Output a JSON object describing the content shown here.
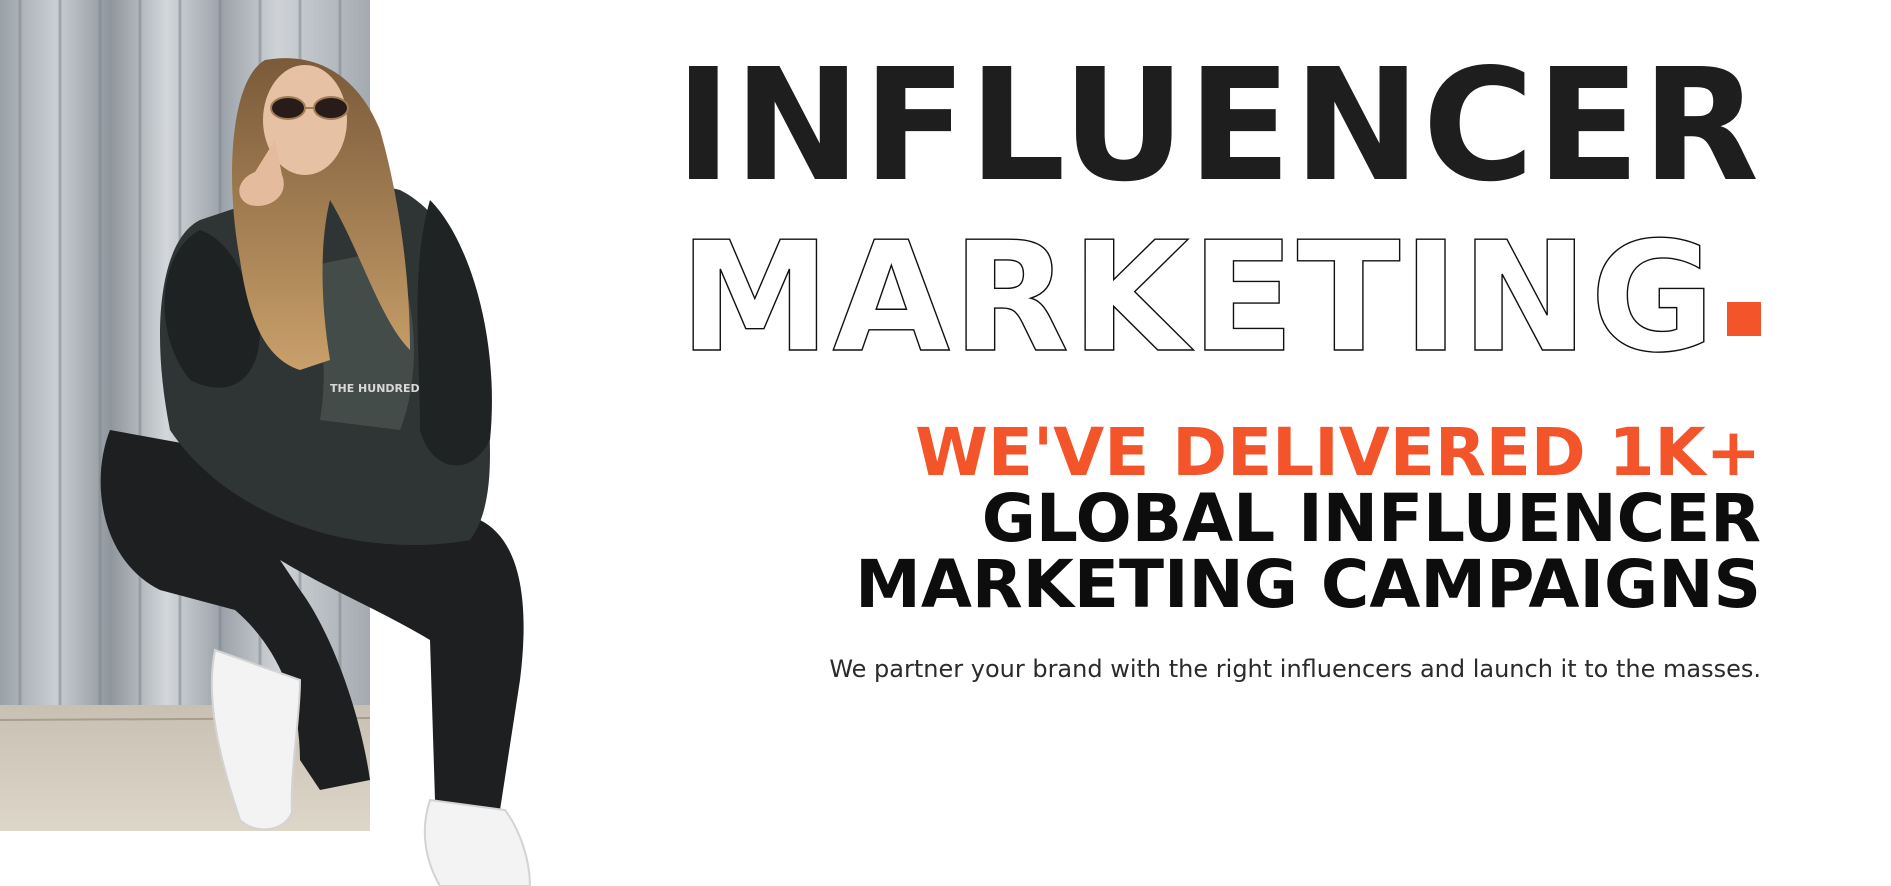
{
  "hero": {
    "image_icon": "person-photo-icon",
    "headline_line_1": "INFLUENCER",
    "headline_line_2": "MARKETING",
    "tagline_accent": "WE'VE DELIVERED 1K+",
    "tagline_line_2": "GLOBAL INFLUENCER",
    "tagline_line_3": "MARKETING CAMPAIGNS",
    "subtitle": "We partner your brand with the right influencers and launch it to the masses."
  },
  "colors": {
    "accent": "#f4542a",
    "text_dark": "#1e1e1e",
    "background": "#ffffff"
  }
}
